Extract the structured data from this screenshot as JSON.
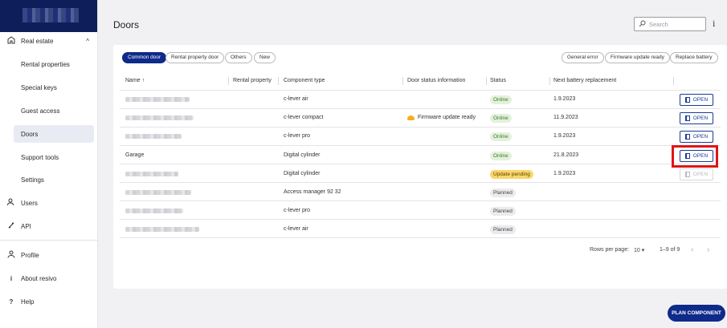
{
  "sidebar": {
    "sections": [
      {
        "label": "Real estate",
        "icon": "building-icon",
        "expanded": true
      },
      {
        "label": "Users",
        "icon": "users-icon"
      },
      {
        "label": "API",
        "icon": "api-icon"
      },
      {
        "label": "Profile",
        "icon": "person-icon"
      },
      {
        "label": "About resivo",
        "icon": "info-icon"
      },
      {
        "label": "Help",
        "icon": "question-icon"
      }
    ],
    "subitems": [
      "Rental properties",
      "Special keys",
      "Guest access",
      "Doors",
      "Support tools",
      "Settings"
    ],
    "active": "Doors"
  },
  "header": {
    "title": "Doors",
    "search_placeholder": "Search"
  },
  "filters": {
    "left": [
      "Common door",
      "Rental property door",
      "Others",
      "New"
    ],
    "selected": "Common door",
    "right": [
      "General error",
      "Firmware update ready",
      "Replace battery"
    ]
  },
  "table": {
    "columns": [
      "Name ↑",
      "Rental property",
      "Component type",
      "Door status information",
      "Status",
      "Next battery replacement"
    ],
    "open_label": "OPEN",
    "rows": [
      {
        "name": "",
        "component": "c-lever air",
        "info": "",
        "status": "Online",
        "battery": "1.9.2023",
        "open_enabled": true
      },
      {
        "name": "",
        "component": "c-lever compact",
        "info": "Firmware update ready",
        "status": "Online",
        "battery": "11.9.2023",
        "open_enabled": true
      },
      {
        "name": "",
        "component": "c-lever pro",
        "info": "",
        "status": "Online",
        "battery": "1.9.2023",
        "open_enabled": true
      },
      {
        "name": "Garage",
        "component": "Digital cylinder",
        "info": "",
        "status": "Online",
        "battery": "21.8.2023",
        "open_enabled": true
      },
      {
        "name": "",
        "component": "Digital cylinder",
        "info": "",
        "status": "Update pending",
        "battery": "1.9.2023",
        "open_enabled": false
      },
      {
        "name": "",
        "component": "Access manager 92 32",
        "info": "",
        "status": "Planned",
        "battery": "",
        "open_enabled": null
      },
      {
        "name": "",
        "component": "c-lever pro",
        "info": "",
        "status": "Planned",
        "battery": "",
        "open_enabled": null
      },
      {
        "name": "",
        "component": "c-lever air",
        "info": "",
        "status": "Planned",
        "battery": "",
        "open_enabled": null
      }
    ]
  },
  "pagination": {
    "rows_per_page_label": "Rows per page:",
    "rows_per_page": "10",
    "range": "1–9 of 9",
    "prev": "‹",
    "next": "›"
  },
  "fab_label": "PLAN COMPONENT",
  "colors": {
    "brand": "#0e1e5b",
    "accent": "#0e2a8a",
    "online_bg": "#e3f1dc",
    "pending_bg": "#fbd66a",
    "highlight": "#e01515"
  }
}
